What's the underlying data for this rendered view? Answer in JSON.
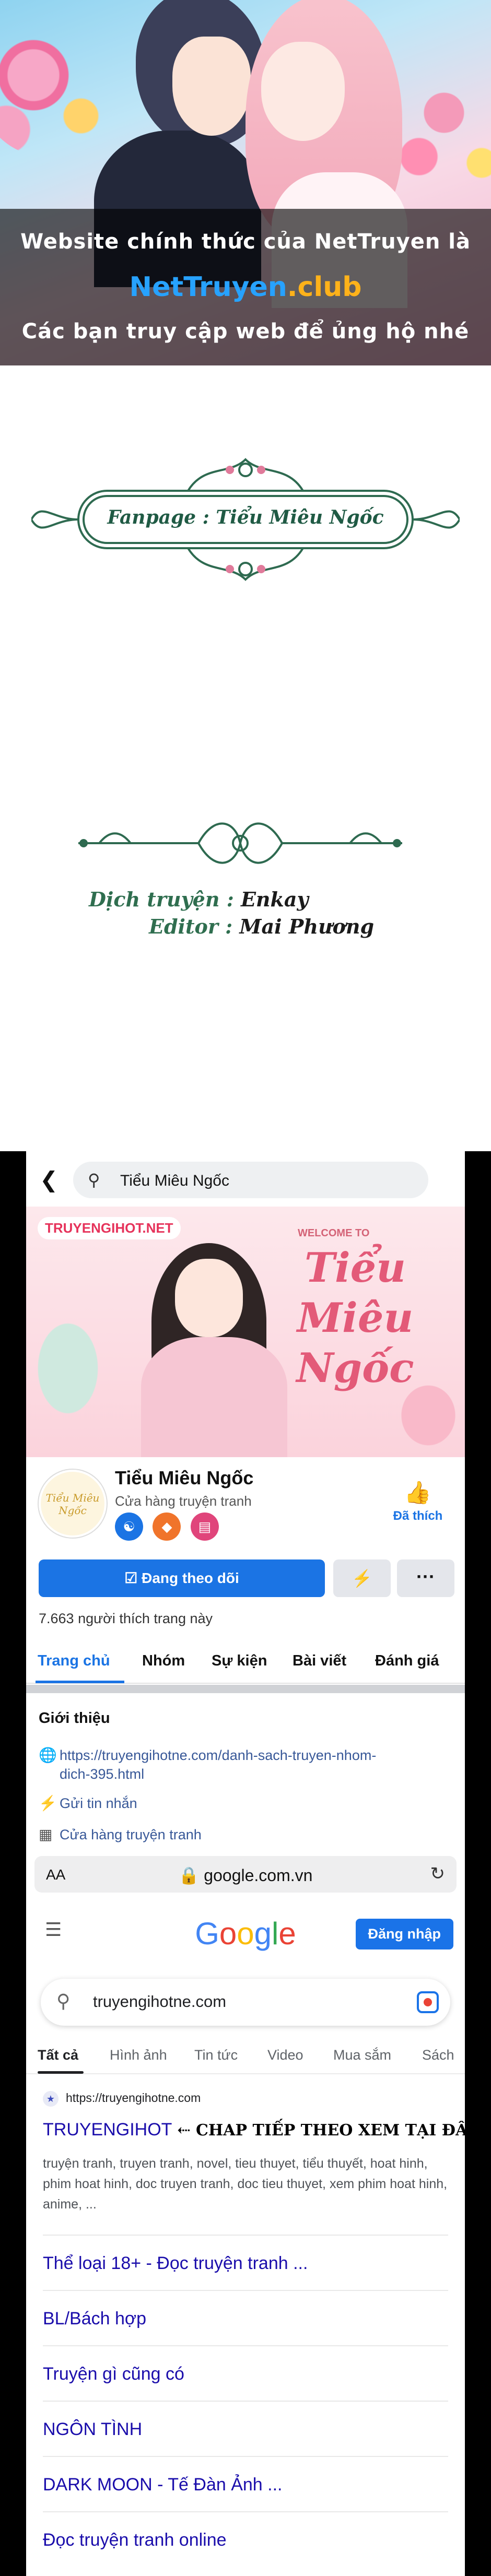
{
  "banner": {
    "line1": "Website chính thức của NetTruyen là",
    "site_part1": "NetTruyen",
    "site_part2": ".club",
    "line3": "Các bạn truy cập web để ủng hộ nhé"
  },
  "credits": {
    "fanpage": "Fanpage : Tiểu Miêu Ngốc",
    "translator_label": "Dịch truyện :",
    "translator": "Enkay",
    "editor_label": "Editor :",
    "editor": "Mai Phương"
  },
  "facebook": {
    "search_text": "Tiểu Miêu Ngốc",
    "cover_watermark": "TRUYENGIHOT.NET",
    "cover_welcome": "WELCOME TO",
    "cover_title": "Tiểu Miêu Ngốc",
    "page_name": "Tiểu Miêu Ngốc",
    "page_category": "Cửa hàng truyện tranh",
    "like_label": "Đã thích",
    "follow_label": "Đang theo dõi",
    "likes_count": "7.663 người thích trang này",
    "tabs": [
      {
        "label": "Trang chủ"
      },
      {
        "label": "Nhóm"
      },
      {
        "label": "Sự kiện"
      },
      {
        "label": "Bài viết"
      },
      {
        "label": "Đánh giá"
      }
    ],
    "intro_title": "Giới thiệu",
    "intro_link_line1": "https://truyengihotne.com/danh-sach-truyen-nhom-",
    "intro_link_line2": "dich-395.html",
    "intro_message": "Gửi tin nhắn",
    "intro_shop": "Cửa hàng truyện tranh"
  },
  "browser": {
    "aa": "AA",
    "address": "google.com.vn"
  },
  "google": {
    "logo_letters": [
      {
        "ch": "G",
        "color": "#4285F4"
      },
      {
        "ch": "o",
        "color": "#EA4335"
      },
      {
        "ch": "o",
        "color": "#FBBC05"
      },
      {
        "ch": "g",
        "color": "#4285F4"
      },
      {
        "ch": "l",
        "color": "#34A853"
      },
      {
        "ch": "e",
        "color": "#EA4335"
      }
    ],
    "signin": "Đăng nhập",
    "query": "truyengihotne.com",
    "tabs": [
      {
        "label": "Tất cả"
      },
      {
        "label": "Hình ảnh"
      },
      {
        "label": "Tin tức"
      },
      {
        "label": "Video"
      },
      {
        "label": "Mua sắm"
      },
      {
        "label": "Sách"
      }
    ],
    "result_site": "https://truyengihotne.com",
    "result_title": "TRUYENGIHOT",
    "result_note": "⇠ CHAP TIẾP THEO XEM TẠI ĐÂY NHA",
    "result_snippet": "truyện tranh, truyen tranh, novel, tieu thuyet, tiểu thuyết, hoat hinh, phim hoat hinh, doc truyen tranh, doc tieu thuyet, xem phim hoat hinh, anime, ...",
    "sitelinks": [
      {
        "label": "Thể loại 18+ - Đọc truyện tranh ..."
      },
      {
        "label": "BL/Bách hợp"
      },
      {
        "label": "Truyện gì cũng có"
      },
      {
        "label": "NGÔN TÌNH"
      },
      {
        "label": "DARK MOON - Tế Đàn Ảnh ..."
      },
      {
        "label": "Đọc truyện tranh online"
      }
    ]
  }
}
